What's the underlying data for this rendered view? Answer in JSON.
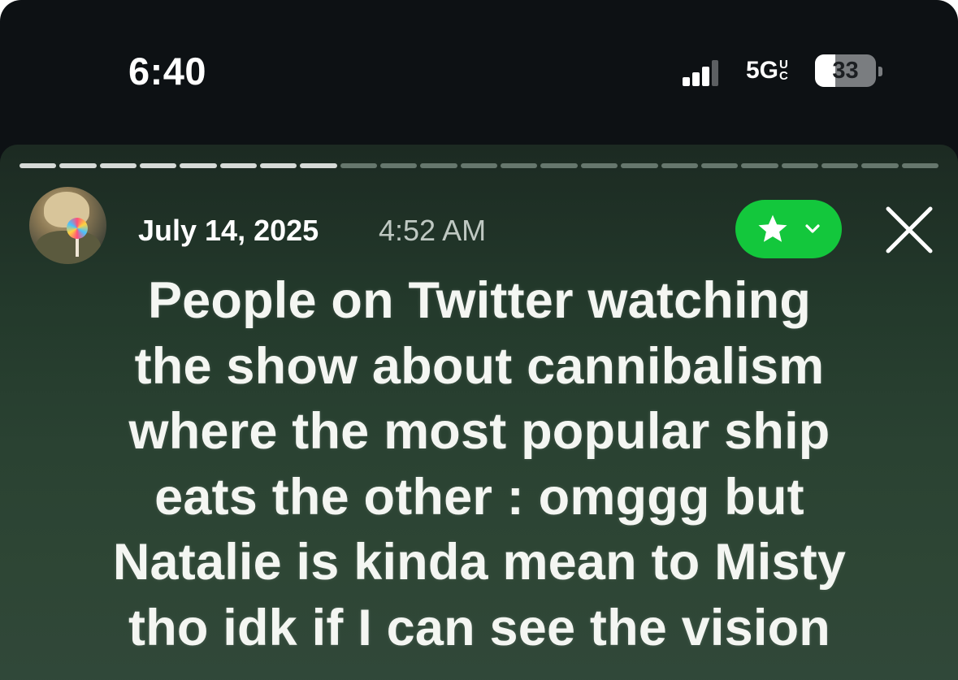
{
  "status_bar": {
    "time": "6:40",
    "network": "5G",
    "network_suffix_top": "U",
    "network_suffix_bottom": "C",
    "battery_percent": "33",
    "battery_level": 0.33,
    "signal_bars_active": 3,
    "signal_bars_total": 4
  },
  "story": {
    "progress_total_segments": 23,
    "progress_seen_segments": 8,
    "date": "July 14, 2025",
    "time": "4:52 AM",
    "avatar_icon": "profile-photo-with-lollipop",
    "favorite_button_icon": "star-icon",
    "favorite_dropdown_icon": "chevron-down-icon",
    "close_icon": "close-icon",
    "accent_color": "#13c73c",
    "caption_lines": [
      "People on Twitter watching",
      "the show about cannibalism",
      "where the most popular ship",
      "eats the other : omggg but",
      "Natalie is kinda mean to Misty",
      "tho idk if I can see the vision"
    ]
  }
}
